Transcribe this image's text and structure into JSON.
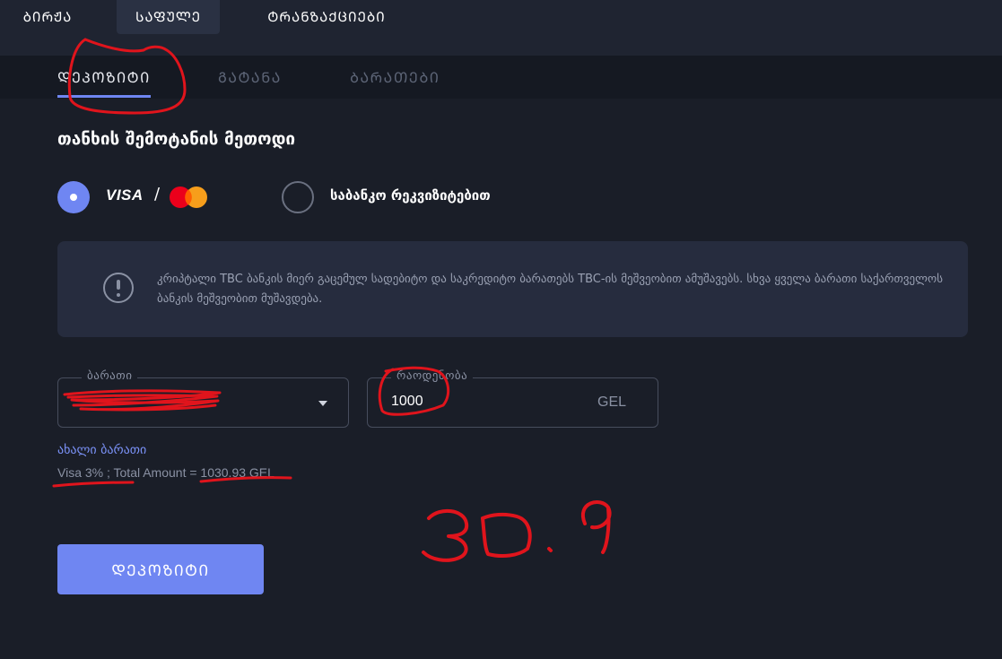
{
  "top_nav": {
    "tabs": [
      {
        "label": "ᲑᲘᲠᲟᲐ"
      },
      {
        "label": "ᲡᲐᲤᲣᲚᲔ"
      },
      {
        "label": "ᲢᲠᲐᲜᲖᲐᲥᲪᲘᲔᲑᲘ"
      }
    ],
    "active_index": 1
  },
  "sub_nav": {
    "tabs": [
      {
        "label": "ᲓᲔᲞᲝᲖᲘᲢᲘ"
      },
      {
        "label": "ᲒᲐᲢᲐᲜᲐ"
      },
      {
        "label": "ᲑᲐᲠᲐᲗᲔᲑᲘ"
      }
    ],
    "active_index": 0
  },
  "deposit": {
    "heading": "თანხის შემოტანის მეთოდი",
    "methods": {
      "card": {
        "visa_logo": "VISA",
        "separator": "/",
        "selected": true
      },
      "bank": {
        "label": "საბანკო რეკვიზიტებით",
        "selected": false
      }
    },
    "info_text": "კრიპტალი TBC ბანკის მიერ გაცემულ სადებიტო და საკრედიტო ბარათებს TBC-ის მეშვეობით ამუშავებს. სხვა ყველა ბარათი საქართველოს ბანკის მეშვეობით მუშავდება.",
    "card_field": {
      "legend": "ბარათი",
      "value": "···"
    },
    "amount_field": {
      "legend": "რაოდენობა",
      "value": "1000",
      "currency": "GEL"
    },
    "new_card_link": "ახალი ბარათი",
    "fee_line": "Visa 3% ; Total Amount = 1030.93 GEL",
    "submit_label": "ᲓᲔᲞᲝᲖᲘᲢᲘ"
  },
  "annotations": {
    "handwritten_note": "30.9",
    "ink_color": "#e0141c"
  },
  "colors": {
    "background": "#1a1e28",
    "accent": "#6f86f2",
    "link": "#7b92f8",
    "muted_text": "#8a91a3"
  }
}
